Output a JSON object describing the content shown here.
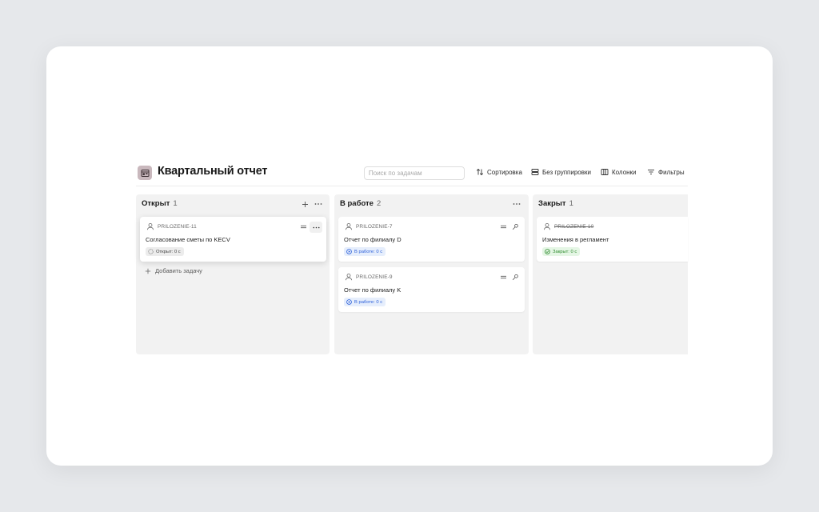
{
  "board": {
    "title": "Квартальный отчет",
    "search": {
      "placeholder": "Поиск по задачам",
      "value": ""
    },
    "toolbar": {
      "sort": "Сортировка",
      "grouping": "Без группировки",
      "columns": "Колонки",
      "filters": "Фильтры"
    }
  },
  "columns": [
    {
      "name": "Открыт",
      "count": "1",
      "add_task_label": "Добавить задачу",
      "cards": [
        {
          "key": "PRILOZENIE-11",
          "title": "Согласование сметы по KECV",
          "status": "Открыт: 0 с",
          "status_type": "open"
        }
      ]
    },
    {
      "name": "В работе",
      "count": "2",
      "cards": [
        {
          "key": "PRILOZENIE-7",
          "title": "Отчет по филиалу D",
          "status": "В работе: 0 с",
          "status_type": "work"
        },
        {
          "key": "PRILOZENIE-9",
          "title": "Отчет по филиалу K",
          "status": "В работе: 0 с",
          "status_type": "work"
        }
      ]
    },
    {
      "name": "Закрыт",
      "count": "1",
      "cards": [
        {
          "key": "PRILOZENIE-10",
          "title": "Изменения в регламент",
          "status": "Закрыт: 0 с",
          "status_type": "closed"
        }
      ]
    }
  ],
  "colors": {
    "status_open_bg": "#ececec",
    "status_work_bg": "#e6eefc",
    "status_work_text": "#2b5fd9",
    "status_closed_bg": "#e5f6e5",
    "status_closed_text": "#2e8b2e",
    "project_icon": "#c9b8bd"
  },
  "icons": {
    "project": "board-icon",
    "sort": "sort-arrows-icon",
    "grouping": "grouping-icon",
    "columns": "columns-icon",
    "filters": "filter-icon",
    "add": "plus-icon",
    "more": "more-dots-icon",
    "assignee": "user-icon",
    "priority": "priority-equal-icon",
    "pin": "pin-icon"
  }
}
